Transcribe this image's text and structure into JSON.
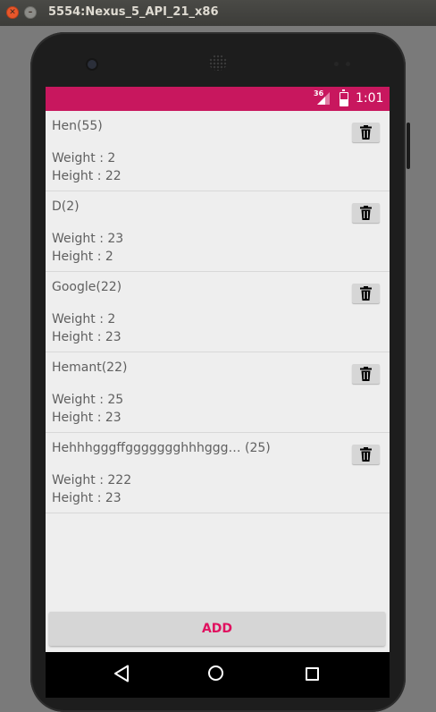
{
  "window": {
    "title": "5554:Nexus_5_API_21_x86"
  },
  "status_bar": {
    "network": "36",
    "time": "1:01",
    "color": "#c8175e"
  },
  "items": [
    {
      "name": "Hen(55)",
      "weight": "Weight : 2",
      "height": "Height : 22"
    },
    {
      "name": "D(2)",
      "weight": "Weight : 23",
      "height": "Height : 2"
    },
    {
      "name": "Google(22)",
      "weight": "Weight : 2",
      "height": "Height : 23"
    },
    {
      "name": "Hemant(22)",
      "weight": "Weight : 25",
      "height": "Height : 23"
    },
    {
      "name": "Hehhhgggffggggggghhhggg… (25)",
      "weight": "Weight : 222",
      "height": "Height : 23"
    }
  ],
  "add_button": {
    "label": "ADD",
    "color": "#e0115f"
  },
  "icons": {
    "delete": "trash-icon",
    "back": "back-icon",
    "home": "home-icon",
    "recents": "recents-icon"
  }
}
